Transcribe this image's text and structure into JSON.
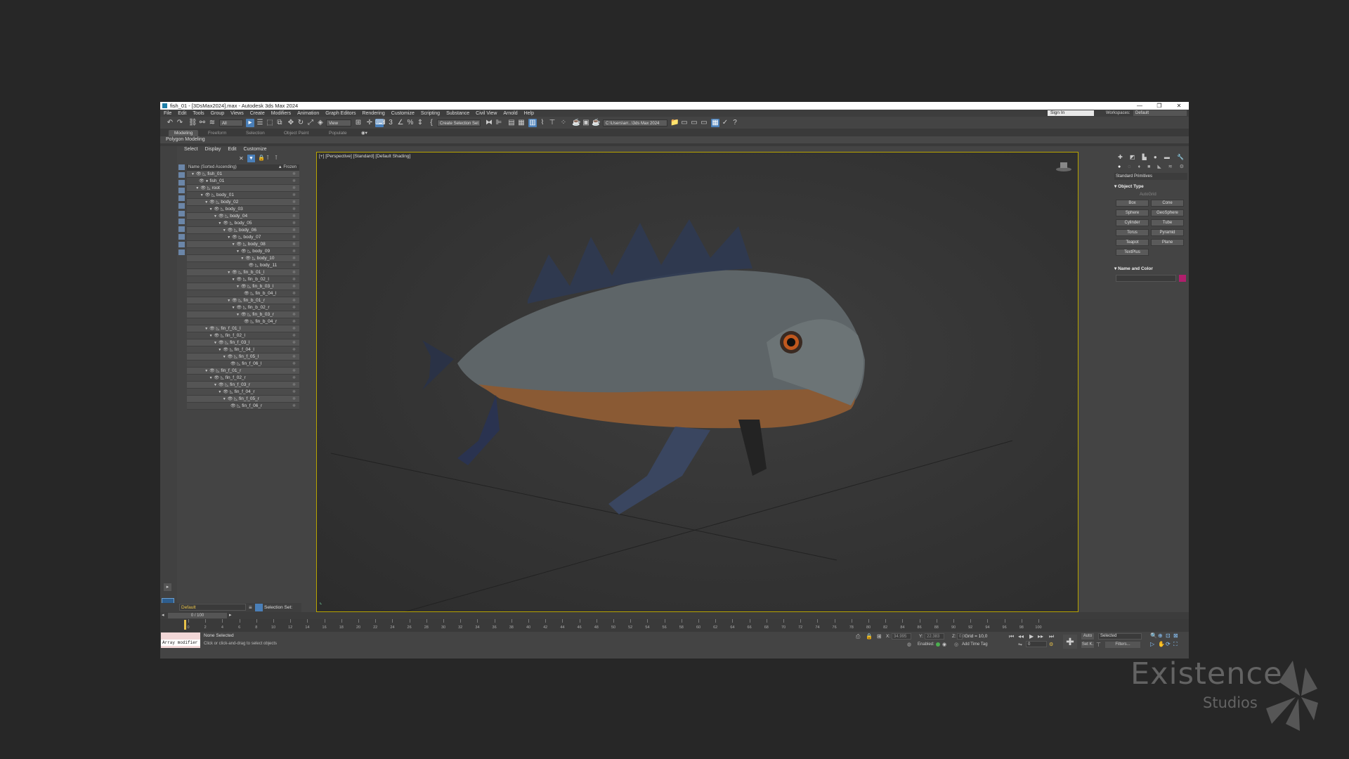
{
  "window": {
    "title": "fish_01 - [3DsMax2024].max - Autodesk 3ds Max 2024",
    "controls": [
      "—",
      "❐",
      "✕"
    ]
  },
  "menu": [
    "File",
    "Edit",
    "Tools",
    "Group",
    "Views",
    "Create",
    "Modifiers",
    "Animation",
    "Graph Editors",
    "Rendering",
    "Customize",
    "Scripting",
    "Substance",
    "Civil View",
    "Arnold",
    "Help"
  ],
  "account": {
    "signin": "Sign In",
    "workspace_label": "Workspaces:",
    "workspace": "Default"
  },
  "toolbar": {
    "filter": "All",
    "coord_system": "View",
    "selection_set": "Create Selection Set",
    "project_path": "C:\\Users\\arr...\\3ds Max 2024"
  },
  "ribbon": {
    "tabs": [
      "Modeling",
      "Freeform",
      "Selection",
      "Object Paint",
      "Populate"
    ],
    "active": "Modeling",
    "sub": "Polygon Modeling"
  },
  "explorer": {
    "menu": [
      "Select",
      "Display",
      "Edit",
      "Customize"
    ],
    "header": "Name (Sorted Ascending)",
    "frozen": "▲ Frozen",
    "rows": [
      {
        "name": "fish_01",
        "d": 0,
        "exp": true
      },
      {
        "name": "fish_01",
        "d": 1,
        "exp": false
      },
      {
        "name": "root",
        "d": 1,
        "exp": true
      },
      {
        "name": "body_01",
        "d": 2,
        "exp": true
      },
      {
        "name": "body_02",
        "d": 3,
        "exp": true
      },
      {
        "name": "body_03",
        "d": 4,
        "exp": true
      },
      {
        "name": "body_04",
        "d": 5,
        "exp": true
      },
      {
        "name": "body_05",
        "d": 6,
        "exp": true
      },
      {
        "name": "body_06",
        "d": 7,
        "exp": true
      },
      {
        "name": "body_07",
        "d": 8,
        "exp": true
      },
      {
        "name": "body_08",
        "d": 9,
        "exp": true
      },
      {
        "name": "body_09",
        "d": 10,
        "exp": true
      },
      {
        "name": "body_10",
        "d": 11,
        "exp": true
      },
      {
        "name": "body_11",
        "d": 12,
        "exp": false
      },
      {
        "name": "fin_b_01_l",
        "d": 8,
        "exp": true
      },
      {
        "name": "fin_b_02_l",
        "d": 9,
        "exp": true
      },
      {
        "name": "fin_b_03_l",
        "d": 10,
        "exp": true
      },
      {
        "name": "fin_b_04_l",
        "d": 11,
        "exp": false
      },
      {
        "name": "fin_b_01_r",
        "d": 8,
        "exp": true
      },
      {
        "name": "fin_b_02_r",
        "d": 9,
        "exp": true
      },
      {
        "name": "fin_b_03_r",
        "d": 10,
        "exp": true
      },
      {
        "name": "fin_b_04_r",
        "d": 11,
        "exp": false
      },
      {
        "name": "fin_f_01_l",
        "d": 3,
        "exp": true
      },
      {
        "name": "fin_f_02_l",
        "d": 4,
        "exp": true
      },
      {
        "name": "fin_f_03_l",
        "d": 5,
        "exp": true
      },
      {
        "name": "fin_f_04_l",
        "d": 6,
        "exp": true
      },
      {
        "name": "fin_f_05_l",
        "d": 7,
        "exp": true
      },
      {
        "name": "fin_f_06_l",
        "d": 8,
        "exp": false
      },
      {
        "name": "fin_f_01_r",
        "d": 3,
        "exp": true
      },
      {
        "name": "fin_f_02_r",
        "d": 4,
        "exp": true
      },
      {
        "name": "fin_f_03_r",
        "d": 5,
        "exp": true
      },
      {
        "name": "fin_f_04_r",
        "d": 6,
        "exp": true
      },
      {
        "name": "fin_f_05_r",
        "d": 7,
        "exp": true
      },
      {
        "name": "fin_f_06_r",
        "d": 8,
        "exp": false
      }
    ]
  },
  "layer": {
    "name": "Default",
    "selection_set_label": "Selection Set:"
  },
  "viewport": {
    "label": "[+] [Perspective] [Standard] [Default Shading]"
  },
  "command_panel": {
    "dropdown": "Standard Primitives",
    "object_type_title": "Object Type",
    "autogrid": "AutoGrid",
    "objects": [
      "Box",
      "Cone",
      "Sphere",
      "GeoSphere",
      "Cylinder",
      "Tube",
      "Torus",
      "Pyramid",
      "Teapot",
      "Plane",
      "TextPlus"
    ],
    "name_color_title": "Name and Color",
    "color": "#b01e6c"
  },
  "timeline": {
    "frame": "0 / 100",
    "ticks": [
      0,
      2,
      4,
      6,
      8,
      10,
      12,
      14,
      16,
      18,
      20,
      22,
      24,
      26,
      28,
      30,
      32,
      34,
      36,
      38,
      40,
      42,
      44,
      46,
      48,
      50,
      52,
      54,
      56,
      58,
      60,
      62,
      64,
      66,
      68,
      70,
      72,
      74,
      76,
      78,
      80,
      82,
      84,
      86,
      88,
      90,
      92,
      94,
      96,
      98,
      100
    ]
  },
  "status": {
    "script": "Array modifier",
    "selection": "None Selected",
    "prompt": "Click or click-and-drag to select objects",
    "x_label": "X:",
    "y_label": "Y:",
    "z_label": "Z:",
    "x_val": "34.995",
    "y_val": "22.383",
    "z_val": "0.0",
    "grid": "Grid = 10,0",
    "enabled": "Enabled:",
    "add_time_tag": "Add Time Tag",
    "auto": "Auto",
    "setk": "Set K.",
    "key_set": "Selected",
    "filters": "Filters...",
    "frame_field": "0"
  },
  "brand": {
    "name": "Existence",
    "sub": "Studios"
  }
}
